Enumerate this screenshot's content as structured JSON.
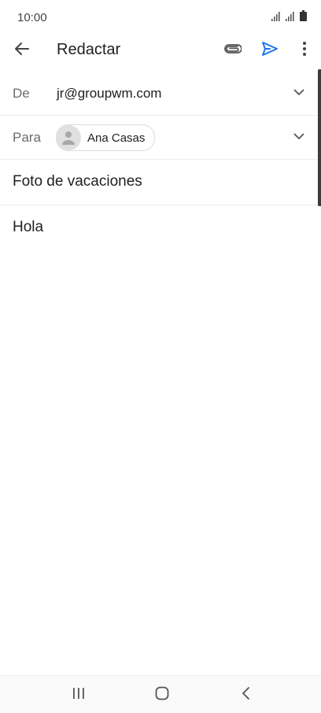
{
  "status_bar": {
    "time": "10:00",
    "icons": [
      "signal-icon",
      "signal-icon",
      "battery-icon"
    ]
  },
  "toolbar": {
    "title": "Redactar",
    "icons": {
      "back": "arrow-left-icon",
      "attach": "paperclip-icon",
      "send": "send-icon",
      "more": "more-vert-icon"
    },
    "send_color": "#1a73e8"
  },
  "fields": {
    "from": {
      "label": "De",
      "value": "jr@groupwm.com"
    },
    "to": {
      "label": "Para",
      "recipients": [
        {
          "name": "Ana Casas"
        }
      ]
    }
  },
  "subject": "Foto de vacaciones",
  "body": "Hola",
  "nav_bar": {
    "icons": [
      "recent-apps-icon",
      "home-icon",
      "back-icon"
    ]
  }
}
